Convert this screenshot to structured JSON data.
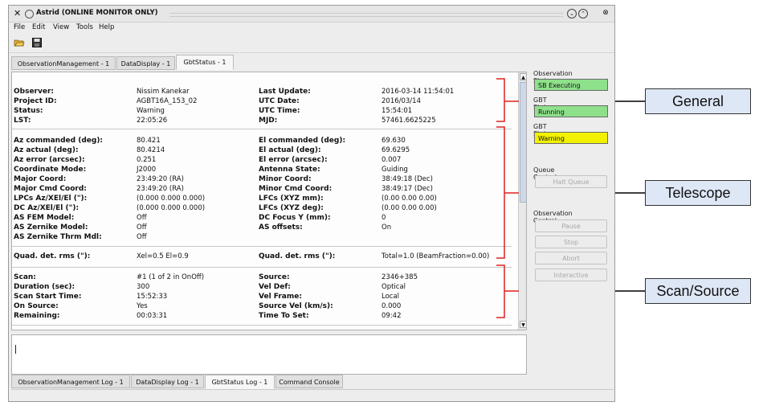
{
  "window": {
    "title": "Astrid (ONLINE MONITOR ONLY)",
    "menu": [
      "File",
      "Edit",
      "View",
      "Tools",
      "Help"
    ]
  },
  "toolbar_icons": [
    "open-folder-icon",
    "save-icon"
  ],
  "top_tabs": [
    "ObservationManagement - 1",
    "DataDisplay - 1",
    "GbtStatus - 1"
  ],
  "top_tabs_active": 2,
  "general": {
    "left": [
      {
        "label": "Observer:",
        "value": "Nissim Kanekar"
      },
      {
        "label": "Project ID:",
        "value": "AGBT16A_153_02"
      },
      {
        "label": "Status:",
        "value": "Warning"
      },
      {
        "label": "LST:",
        "value": "22:05:26"
      }
    ],
    "right": [
      {
        "label": "Last Update:",
        "value": "2016-03-14 11:54:01"
      },
      {
        "label": "UTC Date:",
        "value": "2016/03/14"
      },
      {
        "label": "UTC Time:",
        "value": "15:54:01"
      },
      {
        "label": "MJD:",
        "value": "57461.6625225"
      }
    ]
  },
  "telescope": {
    "left": [
      {
        "label": "Az commanded (deg):",
        "value": "80.421"
      },
      {
        "label": "Az actual (deg):",
        "value": "80.4214"
      },
      {
        "label": "Az error (arcsec):",
        "value": "0.251"
      },
      {
        "label": "Coordinate Mode:",
        "value": "J2000"
      },
      {
        "label": "Major Coord:",
        "value": "23:49:20 (RA)"
      },
      {
        "label": "Major Cmd Coord:",
        "value": "23:49:20 (RA)"
      },
      {
        "label": "LPCs Az/XEl/El (\"):",
        "value": "(0.000 0.000 0.000)"
      },
      {
        "label": "DC Az/XEl/El (\"):",
        "value": "(0.000 0.000 0.000)"
      },
      {
        "label": "AS FEM Model:",
        "value": "Off"
      },
      {
        "label": "AS Zernike Model:",
        "value": "Off"
      },
      {
        "label": "AS Zernike Thrm Mdl:",
        "value": "Off"
      }
    ],
    "right": [
      {
        "label": "El commanded (deg):",
        "value": "69.630"
      },
      {
        "label": "El actual (deg):",
        "value": "69.6295"
      },
      {
        "label": "El error (arcsec):",
        "value": "0.007"
      },
      {
        "label": "Antenna State:",
        "value": "Guiding"
      },
      {
        "label": "Minor Coord:",
        "value": "38:49:18 (Dec)"
      },
      {
        "label": "Minor Cmd Coord:",
        "value": "38:49:17 (Dec)"
      },
      {
        "label": "LFCs (XYZ mm):",
        "value": "(0.00 0.00 0.00)"
      },
      {
        "label": "LFCs (XYZ deg):",
        "value": "(0.00 0.00 0.00)"
      },
      {
        "label": "DC Focus Y (mm):",
        "value": "0"
      },
      {
        "label": "AS offsets:",
        "value": "On"
      }
    ],
    "quad_left": {
      "label": "Quad. det. rms (\"):",
      "value": "Xel=0.5    El=0.9"
    },
    "quad_right": {
      "label": "Quad. det. rms (\"):",
      "value": "Total=1.0 (BeamFraction=0.00)"
    }
  },
  "scan": {
    "left": [
      {
        "label": "Scan:",
        "value": "#1 (1 of 2 in OnOff)"
      },
      {
        "label": "Duration (sec):",
        "value": "300"
      },
      {
        "label": "Scan Start Time:",
        "value": "15:52:33"
      },
      {
        "label": "On Source:",
        "value": "Yes"
      },
      {
        "label": "Remaining:",
        "value": "00:03:31"
      }
    ],
    "right": [
      {
        "label": "Source:",
        "value": "2346+385"
      },
      {
        "label": "Vel Def:",
        "value": "Optical"
      },
      {
        "label": "Vel Frame:",
        "value": "Local"
      },
      {
        "label": "Source Vel (km/s):",
        "value": "0.000"
      },
      {
        "label": "Time To Set:",
        "value": "09:42"
      }
    ]
  },
  "bottom_tabs": [
    "ObservationManagement Log - 1",
    "DataDisplay Log - 1",
    "GbtStatus Log - 1",
    "Command Console"
  ],
  "bottom_tabs_active": 2,
  "right_panel": {
    "observation_state": {
      "label": "Observation State:",
      "value": "SB Executing",
      "color": "#8ee08a"
    },
    "gbt_state": {
      "label": "GBT State:",
      "value": "Running",
      "color": "#8ee08a"
    },
    "gbt_status": {
      "label": "GBT Status:",
      "value": "Warning",
      "color": "#f2f200"
    },
    "queue_control": {
      "label": "Queue Control:",
      "button": "Halt Queue"
    },
    "observation_control": {
      "label": "Observation Control:",
      "buttons": [
        "Pause",
        "Stop",
        "Abort",
        "Interactive"
      ]
    }
  },
  "callouts": [
    "General",
    "Telescope",
    "Scan/Source"
  ],
  "colors": {
    "brace": "#e02020",
    "callout_bg": "#dde7f5"
  }
}
